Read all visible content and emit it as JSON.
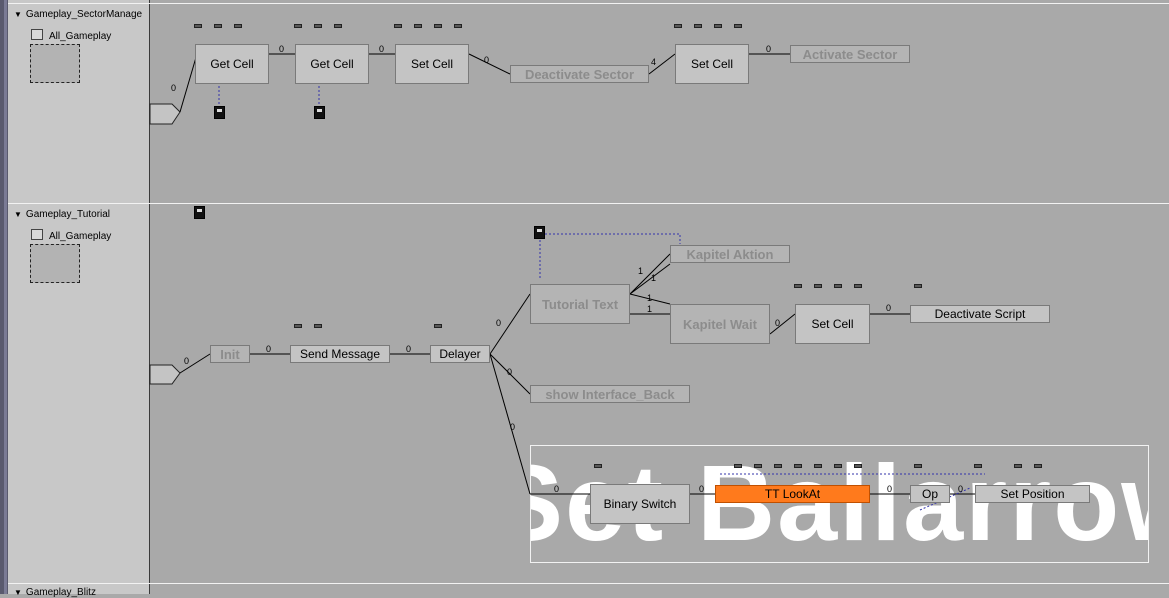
{
  "tree": {
    "sections": [
      {
        "title": "Gameplay_SectorManage",
        "item": "All_Gameplay"
      },
      {
        "title": "Gameplay_Tutorial",
        "item": "All_Gameplay"
      },
      {
        "title": "Gameplay_Blitz"
      }
    ]
  },
  "sector_graph": {
    "nodes": {
      "get_cell_1": "Get Cell",
      "get_cell_2": "Get Cell",
      "set_cell_1": "Set Cell",
      "deactivate_sector": "Deactivate Sector",
      "set_cell_2": "Set Cell",
      "activate_sector": "Activate Sector"
    },
    "link_labels": [
      "0",
      "0",
      "0",
      "0",
      "4",
      "0"
    ]
  },
  "tutorial_graph": {
    "nodes": {
      "init": "Init",
      "send_message": "Send Message",
      "delayer": "Delayer",
      "tutorial_text": "Tutorial Text",
      "kapitel_aktion": "Kapitel Aktion",
      "kapitel_wait": "Kapitel Wait",
      "set_cell": "Set Cell",
      "deactivate_script": "Deactivate Script",
      "show_interface_back": "show Interface_Back",
      "binary_switch": "Binary Switch",
      "tt_lookat": "TT LookAt",
      "op": "Op",
      "set_position": "Set Position"
    },
    "link_labels": [
      "0",
      "0",
      "0",
      "0",
      "0",
      "0",
      "1",
      "1",
      "1",
      "1",
      "0",
      "0",
      "0",
      "0",
      "0",
      "0"
    ]
  },
  "comment_text": "Set Ballarrows",
  "colors": {
    "canvas": "#a9a9a9",
    "panel": "#c8c8c8",
    "highlight": "#ff7a1c"
  }
}
